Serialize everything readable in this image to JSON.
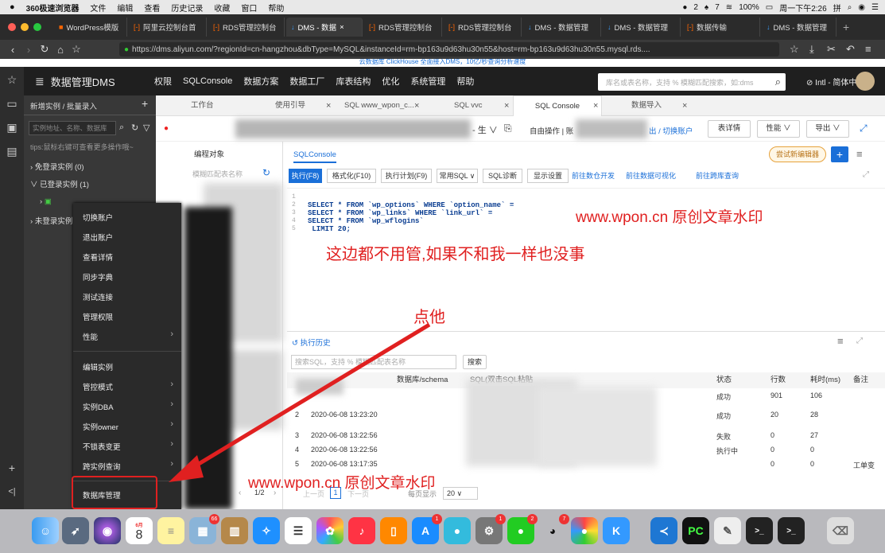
{
  "menubar": {
    "app": "360极速浏览器",
    "items": [
      "文件",
      "编辑",
      "查看",
      "历史记录",
      "收藏",
      "窗口",
      "帮助"
    ],
    "wechat_count": "2",
    "bell_count": "7",
    "battery": "100%",
    "clock": "周一下午2:26"
  },
  "browser_tabs": [
    "WordPress模版",
    "阿里云控制台首",
    "RDS管理控制台",
    "DMS - 数据",
    "RDS管理控制台",
    "RDS管理控制台",
    "DMS - 数据管理",
    "DMS - 数据管理",
    "数据传输",
    "DMS - 数据管理"
  ],
  "url": "https://dms.aliyun.com/?regionId=cn-hangzhou&dbType=MySQL&instanceId=rm-bp163u9d63hu30n55&host=rm-bp163u9d63hu30n55.mysql.rds....",
  "notice": "云数据库 ClickHouse 全面接入DMS，10亿/秒查询分析速度",
  "topnav": {
    "logo": "数据管理DMS",
    "items": [
      "权限",
      "SQLConsole",
      "数据方案",
      "数据工厂",
      "库表结构",
      "优化",
      "系统管理",
      "帮助"
    ],
    "search_placeholder": "库名或表名称，支持 % 模糊匹配搜索，如:dms",
    "lang": "Intl - 简体中文"
  },
  "tree": {
    "header": "新增实例 / 批量录入",
    "search_placeholder": "实例地址、名称、数据库",
    "tips": "tips:鼠标右键可查看更多操作哦~",
    "free_login": "免登录实例 (0)",
    "logged_in": "已登录实例 (1)",
    "not_logged": "未登录实例"
  },
  "context_menu": {
    "items": [
      "切换账户",
      "退出账户",
      "查看详情",
      "同步字典",
      "测试连接",
      "管理权限",
      "性能",
      "编辑实例",
      "管控模式",
      "实例DBA",
      "实例owner",
      "不锁表变更",
      "跨实例查询",
      "数据库管理"
    ]
  },
  "work_tabs": [
    "工作台",
    "使用引导",
    "SQL www_wpon_c...",
    "SQL vvc",
    "SQL Console",
    "数据导入"
  ],
  "toolbar": {
    "env": "- 生",
    "mode": "自由操作 | 账",
    "switch": "出 / 切换账户",
    "form": "表详情",
    "perf": "性能",
    "export": "导出"
  },
  "objpanel": {
    "title": "编程对象",
    "search": "模糊匹配表名称",
    "page": "1/2",
    "page_suffix": "条"
  },
  "editor": {
    "tab": "SQLConsole",
    "try_new": "尝试新编辑器",
    "buttons": [
      "执行(F8)",
      "格式化(F10)",
      "执行计划(F9)",
      "常用SQL",
      "SQL诊断",
      "显示设置"
    ],
    "links": [
      "前往数仓开发",
      "前往数据可视化",
      "前往跨库查询"
    ],
    "code": [
      "SELECT * FROM `wp_options` WHERE `option_name` =",
      "SELECT * FROM `wp_links` WHERE `link_url` =",
      "SELECT * FROM `wp_wflogins`",
      " LIMIT 20;"
    ]
  },
  "history": {
    "title": "执行历史",
    "search": "搜索SQL，支持 % 模糊匹配表名称",
    "search_btn": "搜索",
    "headers": [
      "数据库/schema",
      "SQL(双击SQL粘贴",
      "状态",
      "行数",
      "耗时(ms)",
      "备注"
    ],
    "rows": [
      {
        "idx": "",
        "time": "",
        "status": "成功",
        "rows": "901",
        "ms": "106",
        "note": ""
      },
      {
        "idx": "2",
        "time": "2020-06-08 13:23:20",
        "status": "成功",
        "rows": "20",
        "ms": "28",
        "note": ""
      },
      {
        "idx": "3",
        "time": "2020-06-08 13:22:56",
        "status": "失败",
        "rows": "0",
        "ms": "27",
        "note": ""
      },
      {
        "idx": "4",
        "time": "2020-06-08 13:22:56",
        "status": "执行中",
        "rows": "0",
        "ms": "0",
        "note": ""
      },
      {
        "idx": "5",
        "time": "2020-06-08 13:17:35",
        "status": "",
        "rows": "0",
        "ms": "0",
        "note": "工单变"
      }
    ],
    "pager": {
      "prev": "上一页",
      "cur": "1",
      "next": "下一页",
      "per_page": "每页显示",
      "size": "20"
    }
  },
  "annotations": {
    "watermark": "www.wpon.cn 原创文章水印",
    "note": "这边都不用管,如果不和我一样也没事",
    "click": "点他"
  },
  "dock": {
    "calendar_day": "8",
    "calendar_month": "6月"
  },
  "colors": {
    "accent": "#1a6fd8",
    "annotation": "#e02020"
  }
}
